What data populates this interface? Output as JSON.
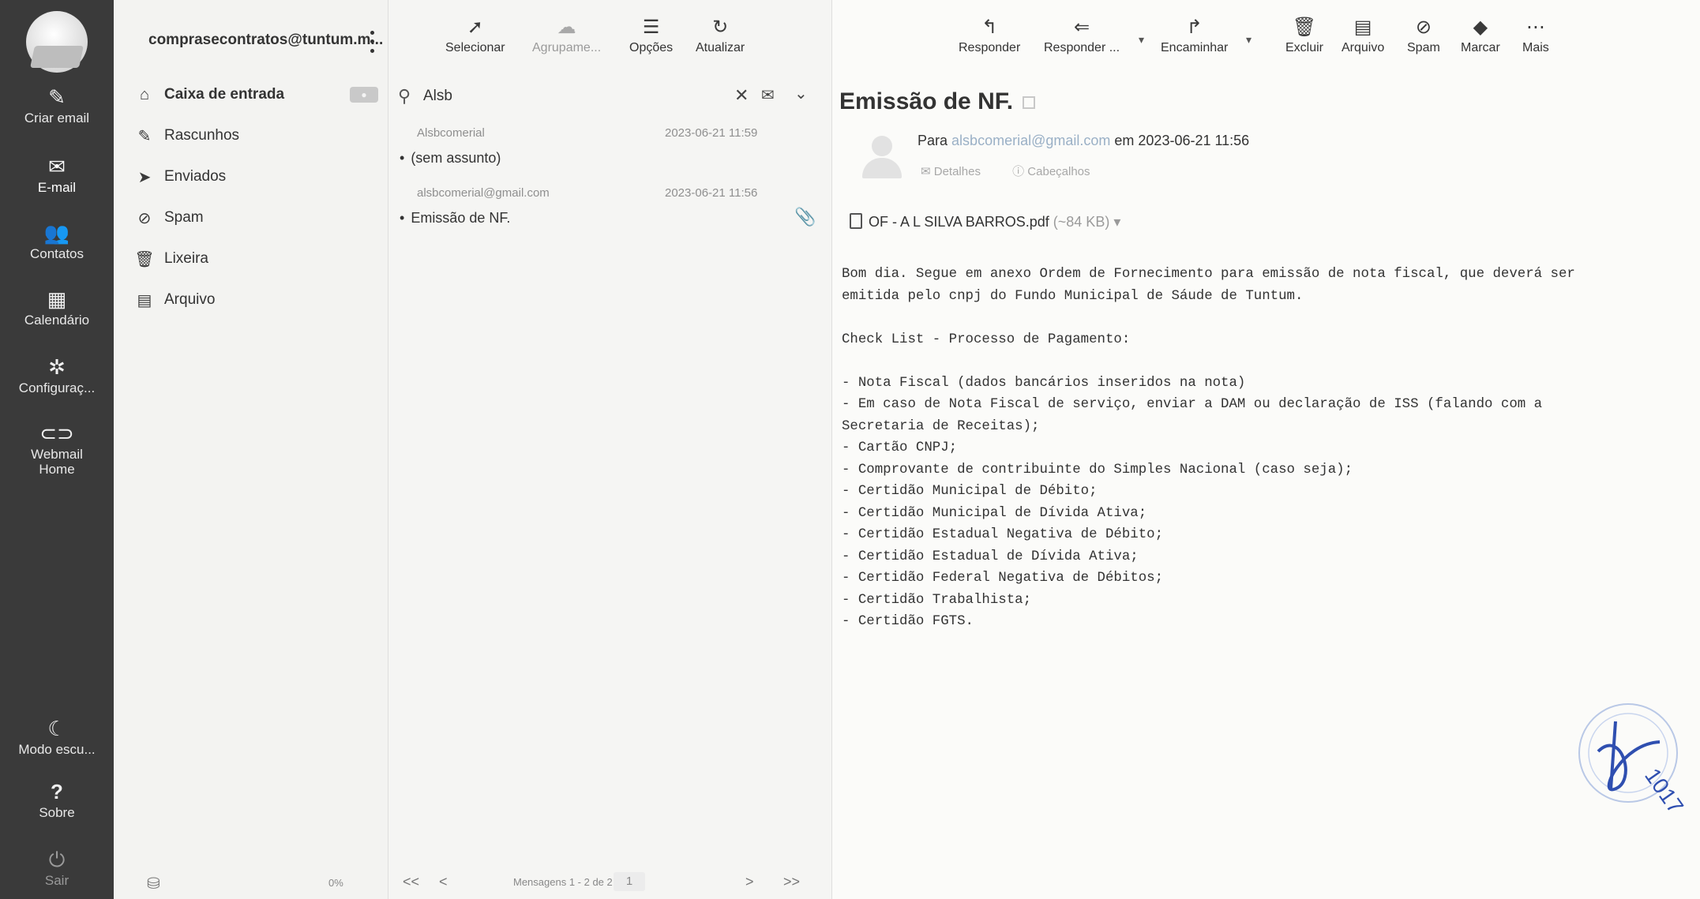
{
  "rail": {
    "items": [
      {
        "label": "Criar email",
        "icon": "compose-icon"
      },
      {
        "label": "E-mail",
        "icon": "mail-icon"
      },
      {
        "label": "Contatos",
        "icon": "contacts-icon"
      },
      {
        "label": "Calendário",
        "icon": "calendar-icon"
      },
      {
        "label": "Configuraç...",
        "icon": "gear-icon"
      },
      {
        "label": "Webmail Home",
        "icon": "link-icon"
      },
      {
        "label": "Modo escu...",
        "icon": "moon-icon"
      },
      {
        "label": "Sobre",
        "icon": "help-icon"
      },
      {
        "label": "Sair",
        "icon": "power-icon"
      }
    ]
  },
  "account": {
    "email": "comprasecontratos@tuntum.m..."
  },
  "folders": [
    {
      "label": "Caixa de entrada",
      "icon": "inbox-icon"
    },
    {
      "label": "Rascunhos",
      "icon": "pencil-icon"
    },
    {
      "label": "Enviados",
      "icon": "send-icon"
    },
    {
      "label": "Spam",
      "icon": "spam-icon"
    },
    {
      "label": "Lixeira",
      "icon": "trash-icon"
    },
    {
      "label": "Arquivo",
      "icon": "archive-icon"
    }
  ],
  "quota": {
    "percent": "0%"
  },
  "list_toolbar": {
    "select": "Selecionar",
    "group": "Agrupame...",
    "options": "Opções",
    "refresh": "Atualizar"
  },
  "search": {
    "value": "Alsb"
  },
  "messages": [
    {
      "from": "Alsbcomerial",
      "date": "2023-06-21 11:59",
      "subject": "(sem assunto)"
    },
    {
      "from": "alsbcomerial@gmail.com",
      "date": "2023-06-21 11:56",
      "subject": "Emissão de NF."
    }
  ],
  "pager": {
    "first": "<<",
    "prev": "<",
    "count": "Mensagens 1 - 2 de 2",
    "page": "1",
    "next": ">",
    "last": ">>"
  },
  "message_toolbar": {
    "reply": "Responder",
    "reply_all": "Responder ...",
    "forward": "Encaminhar",
    "delete": "Excluir",
    "archive": "Arquivo",
    "spam": "Spam",
    "mark": "Marcar",
    "more": "Mais"
  },
  "message": {
    "subject": "Emissão de NF.",
    "to_prefix": "Para",
    "to_address": "alsbcomerial@gmail.com",
    "date_text": "em 2023-06-21 11:56",
    "details": "Detalhes",
    "headers": "Cabeçalhos",
    "attachment_name": "OF - A L SILVA BARROS.pdf",
    "attachment_size": "(~84 KB)",
    "body_lines": [
      "Bom dia. Segue em anexo Ordem de Fornecimento para emissão de nota fiscal, que deverá ser",
      "emitida pelo cnpj do Fundo Municipal de Sáude de Tuntum.",
      "",
      "Check List - Processo de Pagamento:",
      "",
      "- Nota Fiscal (dados bancários inseridos na nota)",
      "- Em caso de Nota Fiscal de serviço, enviar a DAM ou declaração de ISS (falando com a",
      "Secretaria de Receitas);",
      "- Cartão CNPJ;",
      "- Comprovante de contribuinte do Simples Nacional (caso seja);",
      "- Certidão Municipal de Débito;",
      "- Certidão Municipal de Dívida Ativa;",
      "- Certidão Estadual Negativa de Débito;",
      "- Certidão Estadual de Dívida Ativa;",
      "- Certidão Federal Negativa de Débitos;",
      "- Certidão Trabalhista;",
      "- Certidão FGTS."
    ]
  },
  "stamp": {
    "text": "1017"
  }
}
